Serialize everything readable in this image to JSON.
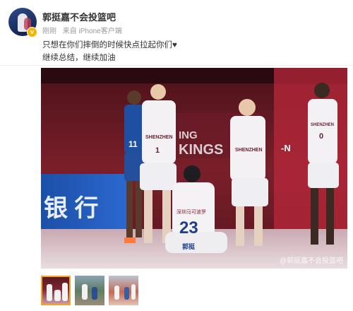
{
  "post": {
    "username": "郭挺嘉不会投篮吧",
    "time": "刚刚",
    "source": "来自 iPhone客户端",
    "text_line1": "只想在你们摔倒的时候快点拉起你们♥",
    "text_line2": "继续总结，继续加油"
  },
  "photo": {
    "watermark": "@郭挺嘉不会投篮吧",
    "jerseys": [
      "11",
      "1",
      "23",
      "0"
    ],
    "jersey_text": [
      "SHENZHEN",
      "SHENZHEN",
      "SHENZHEN"
    ],
    "court_text": [
      "ING",
      "KINGS",
      "银 行",
      "-N"
    ],
    "player_name_back": "郭挺",
    "back_team_text": "深圳马可波罗"
  },
  "thumbnails": [
    {
      "label": "image 1",
      "selected": true
    },
    {
      "label": "image 2",
      "selected": false
    },
    {
      "label": "image 3",
      "selected": false
    }
  ]
}
